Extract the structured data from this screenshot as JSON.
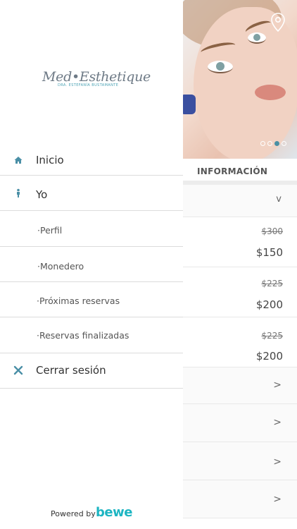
{
  "drawer": {
    "logo": {
      "name": "Med•Esthetique",
      "tagline": "DRA. ESTEFANÍA BUSTAMANTE"
    },
    "menu": [
      {
        "label": "Inicio",
        "icon": "home-icon"
      },
      {
        "label": "Yo",
        "icon": "person-icon"
      },
      {
        "label": "·Perfil"
      },
      {
        "label": "·Monedero"
      },
      {
        "label": "·Próximas reservas"
      },
      {
        "label": "·Reservas finalizadas"
      },
      {
        "label": "Cerrar sesión",
        "icon": "close-icon"
      }
    ],
    "powered_by": "Powered by",
    "brand": "bewe"
  },
  "background": {
    "location_icon": "map-pin-icon",
    "carousel": {
      "count": 4,
      "active_index": 2
    },
    "section_title": "INFORMACIÓN",
    "rows": [
      {
        "type": "expander",
        "chevron": "v"
      },
      {
        "type": "price",
        "old_price": "$300",
        "new_price": "$150"
      },
      {
        "type": "price",
        "old_price": "$225",
        "new_price": "$200"
      },
      {
        "type": "price",
        "old_price": "$225",
        "new_price": "$200"
      },
      {
        "type": "link",
        "chevron": ">"
      },
      {
        "type": "link",
        "chevron": ">"
      },
      {
        "type": "link",
        "chevron": ">"
      },
      {
        "type": "link",
        "chevron": ">"
      }
    ]
  },
  "colors": {
    "accent": "#4a8fa6",
    "brand": "#1db5c2",
    "divider": "#dcdcdc"
  }
}
